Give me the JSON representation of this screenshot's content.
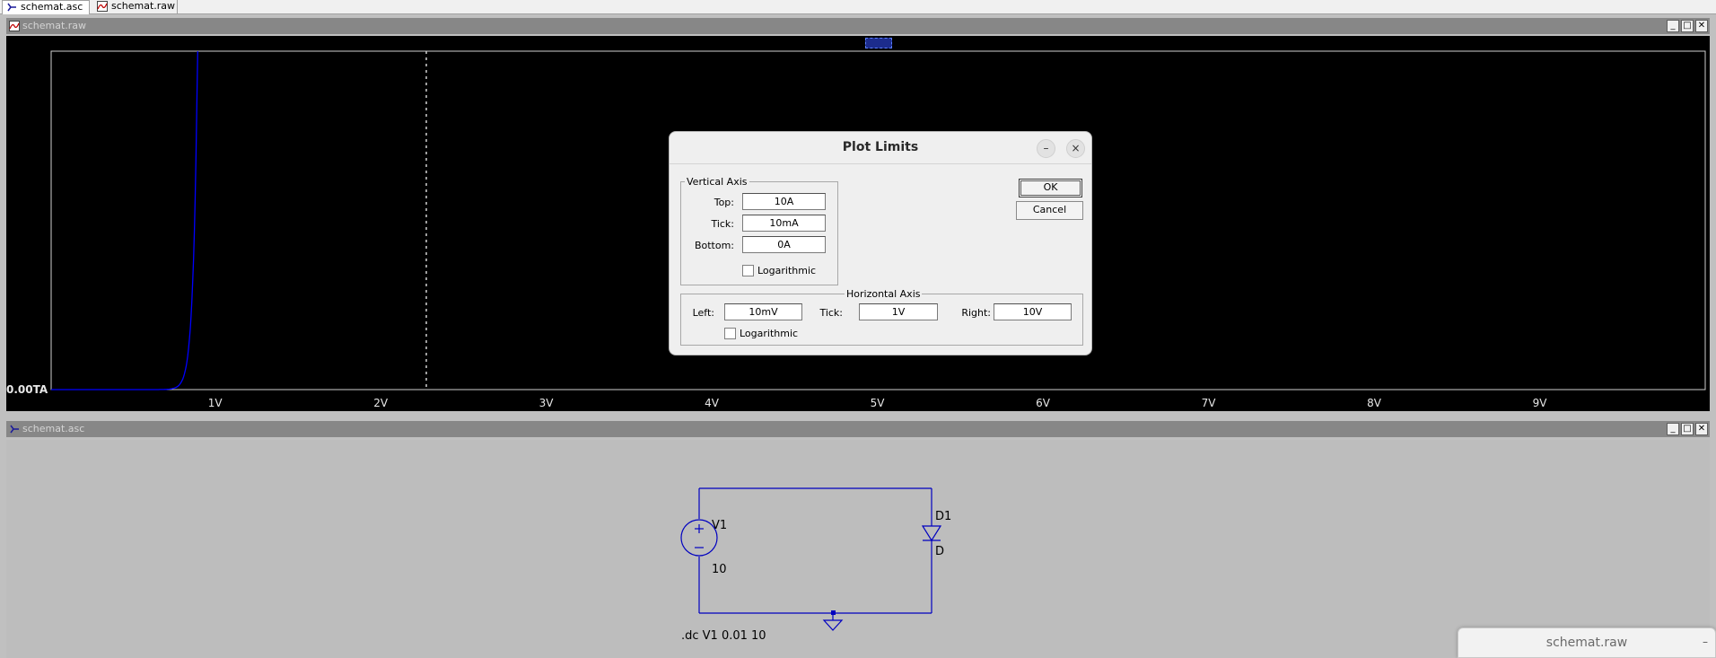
{
  "tabs": [
    {
      "label": "schemat.asc",
      "icon": "schematic-icon"
    },
    {
      "label": "schemat.raw",
      "icon": "waveform-icon"
    }
  ],
  "plot_window": {
    "title": "schemat.raw",
    "y_axis_label": "0.00TA",
    "x_tick_labels": [
      "1V",
      "2V",
      "3V",
      "4V",
      "5V",
      "6V",
      "7V",
      "8V",
      "9V"
    ],
    "trace_color": "#0000ff"
  },
  "schematic_window": {
    "title": "schemat.asc",
    "v1_name": "V1",
    "v1_value": "10",
    "d1_name": "D1",
    "d1_model": "D",
    "directive": ".dc V1 0.01 10",
    "wire_color": "#0000c0"
  },
  "floating_window": {
    "title": "schemat.raw",
    "min_symbol": "–"
  },
  "dialog": {
    "title": "Plot Limits",
    "minimize_symbol": "–",
    "close_symbol": "×",
    "vertical": {
      "legend": "Vertical Axis",
      "top_label": "Top:",
      "top_value": "10A",
      "tick_label": "Tick:",
      "tick_value": "10mA",
      "bottom_label": "Bottom:",
      "bottom_value": "0A",
      "log_label": "Logarithmic"
    },
    "horizontal": {
      "legend": "Horizontal Axis",
      "left_label": "Left:",
      "left_value": "10mV",
      "tick_label": "Tick:",
      "tick_value": "1V",
      "right_label": "Right:",
      "right_value": "10V",
      "log_label": "Logarithmic"
    },
    "ok_label": "OK",
    "cancel_label": "Cancel"
  },
  "window_controls": {
    "minimize": "_",
    "maximize": "□",
    "close": "✕"
  }
}
